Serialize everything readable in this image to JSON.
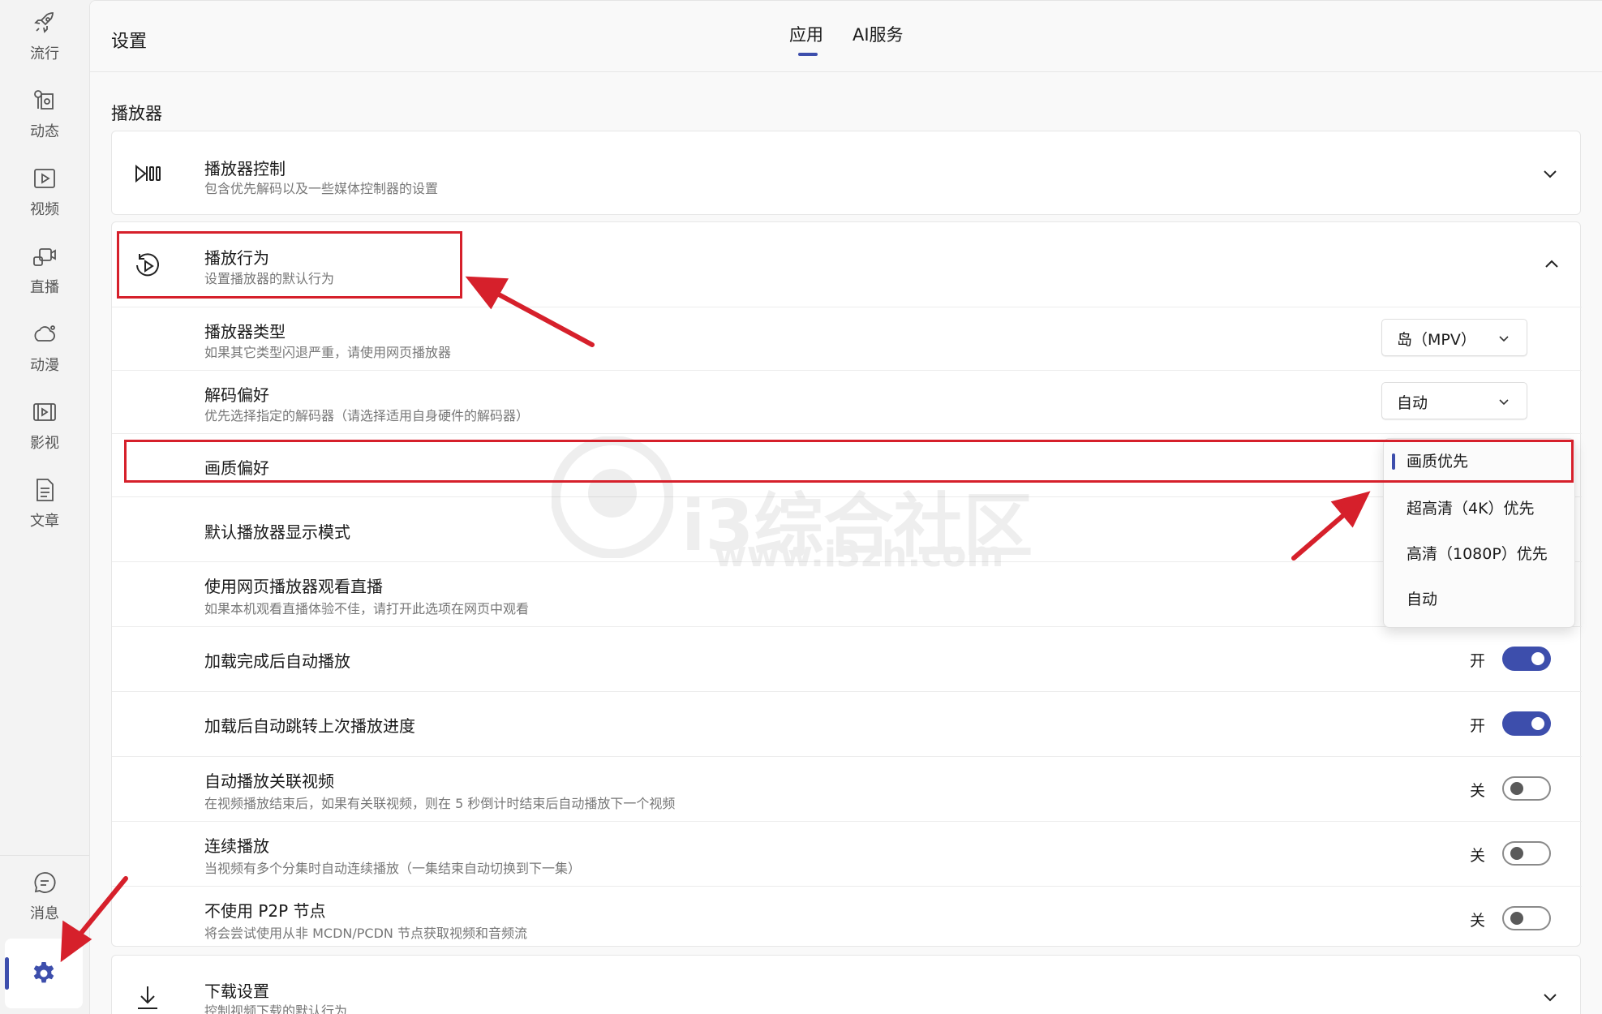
{
  "sidebar": {
    "items": [
      {
        "label": "流行",
        "icon": "rocket-icon"
      },
      {
        "label": "动态",
        "icon": "dynamic-icon"
      },
      {
        "label": "视频",
        "icon": "video-icon"
      },
      {
        "label": "直播",
        "icon": "live-icon"
      },
      {
        "label": "动漫",
        "icon": "anime-icon"
      },
      {
        "label": "影视",
        "icon": "film-icon"
      },
      {
        "label": "文章",
        "icon": "article-icon"
      }
    ],
    "messages_label": "消息",
    "settings_icon": "gear-icon"
  },
  "header": {
    "title": "设置",
    "tabs": [
      {
        "label": "应用",
        "active": true
      },
      {
        "label": "AI服务",
        "active": false
      }
    ]
  },
  "section": {
    "title": "播放器"
  },
  "player_control": {
    "title": "播放器控制",
    "desc": "包含优先解码以及一些媒体控制器的设置",
    "icon": "player-control-icon",
    "expanded": false
  },
  "player_behavior": {
    "title": "播放行为",
    "desc": "设置播放器的默认行为",
    "icon": "replay-icon",
    "expanded": true,
    "rows": {
      "player_type": {
        "title": "播放器类型",
        "desc": "如果其它类型闪退严重，请使用网页播放器",
        "value": "岛（MPV）"
      },
      "decode": {
        "title": "解码偏好",
        "desc": "优先选择指定的解码器（请选择适用自身硬件的解码器）",
        "value": "自动"
      },
      "quality": {
        "title": "画质偏好"
      },
      "display_mode": {
        "title": "默认播放器显示模式"
      },
      "web_live": {
        "title": "使用网页播放器观看直播",
        "desc": "如果本机观看直播体验不佳，请打开此选项在网页中观看"
      },
      "autoplay": {
        "title": "加载完成后自动播放",
        "state_label": "开",
        "on": true
      },
      "resume": {
        "title": "加载后自动跳转上次播放进度",
        "state_label": "开",
        "on": true
      },
      "related": {
        "title": "自动播放关联视频",
        "desc": "在视频播放结束后，如果有关联视频，则在 5 秒倒计时结束后自动播放下一个视频",
        "state_label": "关",
        "on": false
      },
      "continuous": {
        "title": "连续播放",
        "desc": "当视频有多个分集时自动连续播放（一集结束自动切换到下一集）",
        "state_label": "关",
        "on": false
      },
      "p2p": {
        "title": "不使用 P2P 节点",
        "desc": "将会尝试使用从非 MCDN/PCDN 节点获取视频和音频流",
        "state_label": "关",
        "on": false
      }
    }
  },
  "quality_menu": {
    "options": [
      "画质优先",
      "超高清（4K）优先",
      "高清（1080P）优先",
      "自动"
    ],
    "selected": "画质优先"
  },
  "download_settings": {
    "title": "下载设置",
    "desc": "控制视频下载的默认行为",
    "icon": "download-icon"
  },
  "watermark": {
    "text": "i3综合社区",
    "url": "www.i3zh.com"
  },
  "colors": {
    "accent": "#3d4eac",
    "annotation_red": "#d6202b"
  }
}
